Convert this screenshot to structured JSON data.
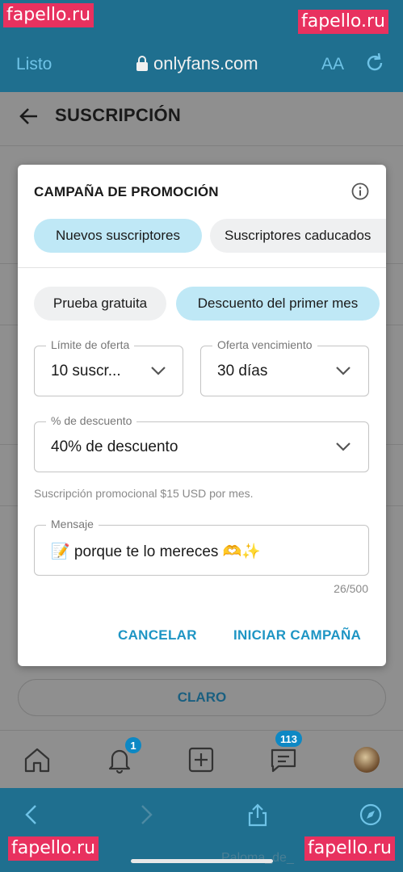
{
  "watermarks": {
    "top_left": "fapello.ru",
    "top_right": "fapello.ru",
    "bottom_left": "fapello.ru",
    "bottom_right": "fapello.ru"
  },
  "browser": {
    "done_label": "Listo",
    "url": "onlyfans.com",
    "text_size_label": "AA",
    "icons": [
      "lock-icon",
      "text-size-icon",
      "reload-icon"
    ]
  },
  "page": {
    "title": "SUSCRIPCIÓN",
    "clear_button": "CLARO"
  },
  "modal": {
    "title": "CAMPAÑA DE PROMOCIÓN",
    "audience_tabs": [
      {
        "label": "Nuevos suscriptores",
        "active": true
      },
      {
        "label": "Suscriptores caducados",
        "active": false
      }
    ],
    "offer_types": [
      {
        "label": "Prueba gratuita",
        "active": false
      },
      {
        "label": "Descuento del primer mes",
        "active": true
      }
    ],
    "offer_limit": {
      "label": "Límite de oferta",
      "value": "10 suscr..."
    },
    "offer_expiration": {
      "label": "Oferta vencimiento",
      "value": "30 días"
    },
    "discount": {
      "label": "% de descuento",
      "value": "40% de descuento"
    },
    "hint": "Suscripción promocional $15 USD por mes.",
    "message": {
      "label": "Mensaje",
      "value": "📝 porque te lo mereces 🫶✨",
      "counter": "26/500"
    },
    "cancel_label": "CANCELAR",
    "start_label": "INICIAR CAMPAÑA"
  },
  "tabbar": {
    "notifications_badge": "1",
    "messages_badge": "113"
  },
  "footer": {
    "username": "Paloma_de_"
  },
  "colors": {
    "browser_bar": "#1f6f8f",
    "accent": "#1e95c4",
    "active_pill": "#bfe8f6",
    "watermark": "#e8315f"
  }
}
